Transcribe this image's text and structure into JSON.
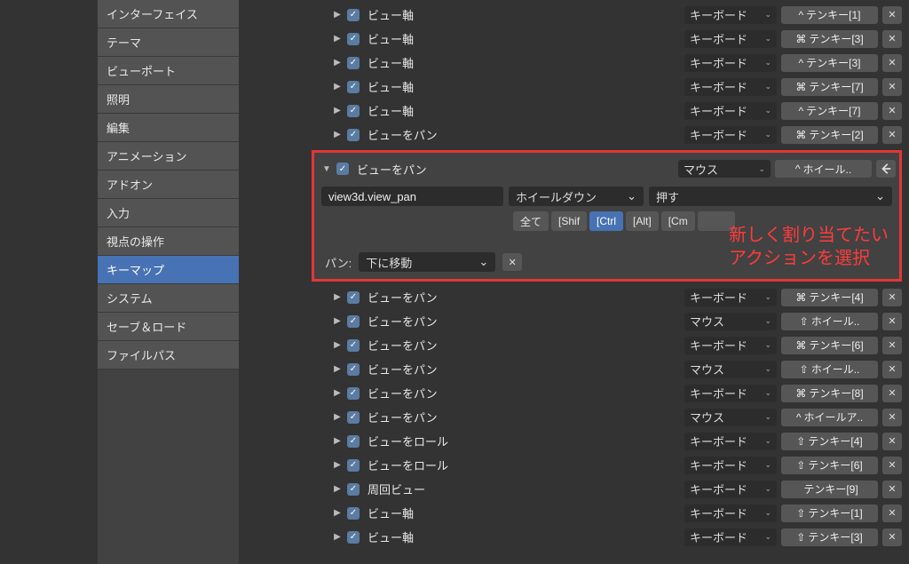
{
  "sidebar": {
    "items": [
      {
        "label": "インターフェイス",
        "active": false
      },
      {
        "label": "テーマ",
        "active": false
      },
      {
        "label": "ビューポート",
        "active": false
      },
      {
        "label": "照明",
        "active": false
      },
      {
        "label": "編集",
        "active": false
      },
      {
        "label": "アニメーション",
        "active": false
      },
      {
        "label": "アドオン",
        "active": false
      },
      {
        "label": "入力",
        "active": false
      },
      {
        "label": "視点の操作",
        "active": false
      },
      {
        "label": "キーマップ",
        "active": true
      },
      {
        "label": "システム",
        "active": false
      },
      {
        "label": "セーブ＆ロード",
        "active": false
      },
      {
        "label": "ファイルパス",
        "active": false
      }
    ]
  },
  "rows_before": [
    {
      "label": "ビュー軸",
      "device": "キーボード",
      "mod": "^",
      "key": "テンキー[1]"
    },
    {
      "label": "ビュー軸",
      "device": "キーボード",
      "mod": "⌘",
      "key": "テンキー[3]"
    },
    {
      "label": "ビュー軸",
      "device": "キーボード",
      "mod": "^",
      "key": "テンキー[3]"
    },
    {
      "label": "ビュー軸",
      "device": "キーボード",
      "mod": "⌘",
      "key": "テンキー[7]"
    },
    {
      "label": "ビュー軸",
      "device": "キーボード",
      "mod": "^",
      "key": "テンキー[7]"
    },
    {
      "label": "ビューをパン",
      "device": "キーボード",
      "mod": "⌘",
      "key": "テンキー[2]"
    }
  ],
  "expanded": {
    "label": "ビューをパン",
    "device": "マウス",
    "key_mod": "^",
    "key": "ホイール..",
    "operator": "view3d.view_pan",
    "event": "ホイールダウン",
    "press": "押す",
    "mods": {
      "all": "全て",
      "shift": "[Shif",
      "ctrl": "[Ctrl",
      "alt": "[Alt]",
      "cmd": "[Cm"
    },
    "pan_label": "パン:",
    "pan_value": "下に移動",
    "annotation_line1": "新しく割り当てたい",
    "annotation_line2": "アクションを選択"
  },
  "rows_after": [
    {
      "label": "ビューをパン",
      "device": "キーボード",
      "mod": "⌘",
      "key": "テンキー[4]"
    },
    {
      "label": "ビューをパン",
      "device": "マウス",
      "mod": "⇧",
      "key": "ホイール.."
    },
    {
      "label": "ビューをパン",
      "device": "キーボード",
      "mod": "⌘",
      "key": "テンキー[6]"
    },
    {
      "label": "ビューをパン",
      "device": "マウス",
      "mod": "⇧",
      "key": "ホイール.."
    },
    {
      "label": "ビューをパン",
      "device": "キーボード",
      "mod": "⌘",
      "key": "テンキー[8]"
    },
    {
      "label": "ビューをパン",
      "device": "マウス",
      "mod": "^",
      "key": "ホイールア.."
    },
    {
      "label": "ビューをロール",
      "device": "キーボード",
      "mod": "⇧",
      "key": "テンキー[4]"
    },
    {
      "label": "ビューをロール",
      "device": "キーボード",
      "mod": "⇧",
      "key": "テンキー[6]"
    },
    {
      "label": "周回ビュー",
      "device": "キーボード",
      "mod": "",
      "key": "テンキー[9]"
    },
    {
      "label": "ビュー軸",
      "device": "キーボード",
      "mod": "⇧",
      "key": "テンキー[1]"
    },
    {
      "label": "ビュー軸",
      "device": "キーボード",
      "mod": "⇧",
      "key": "テンキー[3]"
    }
  ]
}
